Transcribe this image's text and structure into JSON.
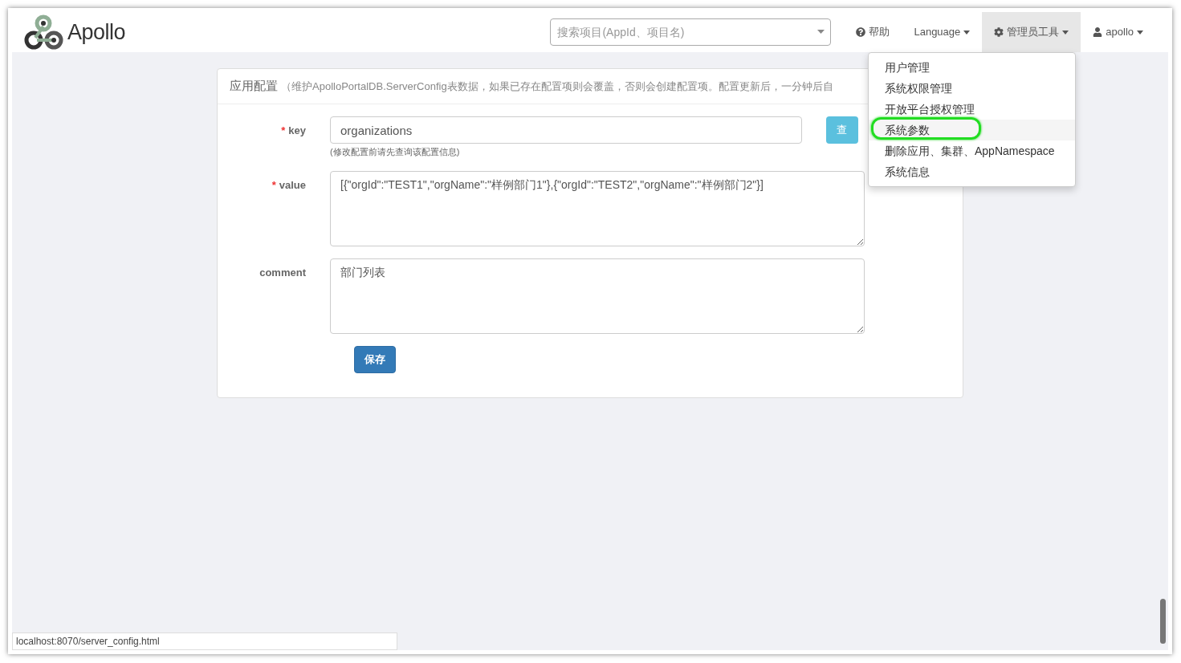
{
  "navbar": {
    "brand": "Apollo",
    "search": {
      "placeholder": "搜索项目(AppId、项目名)"
    },
    "items": [
      {
        "kind": "help",
        "label": "帮助",
        "selected": false
      },
      {
        "kind": "caret",
        "label": "Language",
        "selected": false
      },
      {
        "kind": "admin",
        "label": "管理员工具",
        "selected": true
      },
      {
        "kind": "user",
        "label": "apollo",
        "selected": false
      }
    ]
  },
  "admin_menu": [
    {
      "label": "用户管理",
      "selected": false
    },
    {
      "label": "系统权限管理",
      "selected": false
    },
    {
      "label": "开放平台授权管理",
      "selected": false
    },
    {
      "label": "系统参数",
      "selected": true
    },
    {
      "label": "删除应用、集群、AppNamespace",
      "selected": false
    },
    {
      "label": "系统信息",
      "selected": false
    }
  ],
  "panel": {
    "title": "应用配置",
    "subtitle": "（维护ApolloPortalDB.ServerConfig表数据，如果已存在配置项则会覆盖，否则会创建配置项。配置更新后，一分钟后自",
    "fields": [
      {
        "kind": "input",
        "label": "key",
        "required_mark": "*",
        "value": "organizations",
        "button": "查",
        "help": "(修改配置前请先查询该配置信息)"
      },
      {
        "kind": "textarea",
        "label": "value",
        "required_mark": "*",
        "value": "[{\"orgId\":\"TEST1\",\"orgName\":\"样例部门1\"},{\"orgId\":\"TEST2\",\"orgName\":\"样例部门2\"}]"
      },
      {
        "kind": "textarea",
        "label": "comment",
        "value": "部门列表"
      }
    ],
    "save": "保存"
  },
  "status_url": "localhost:8070/server_config.html"
}
